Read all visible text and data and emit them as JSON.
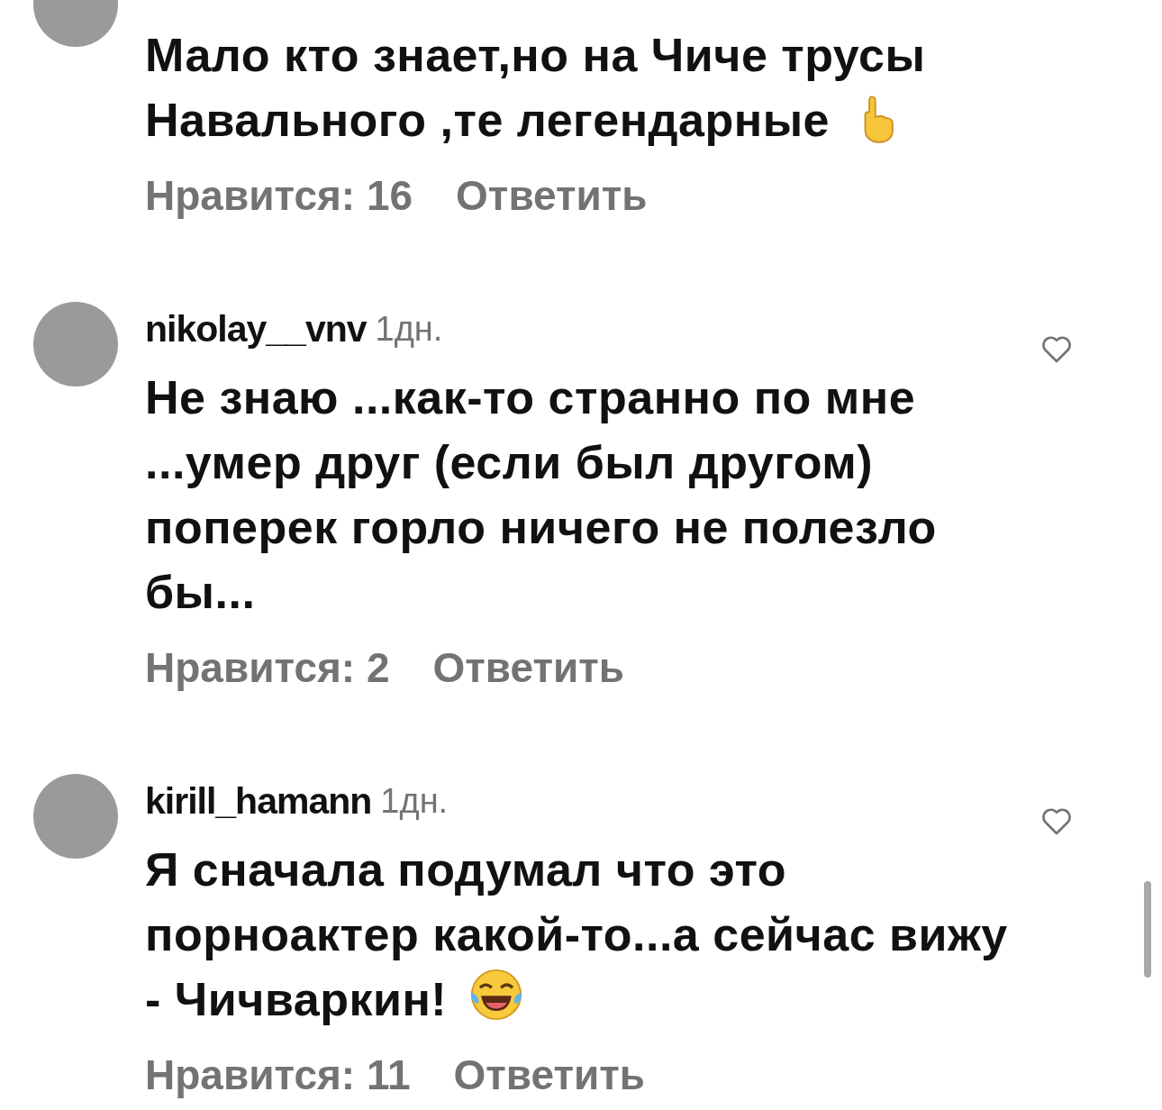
{
  "comments": [
    {
      "text": "Мало кто знает,но на Чиче трусы Навального ,те легендарные",
      "kind": "finger-emoji",
      "likes": "Нравится: 16",
      "reply": "Ответить"
    },
    {
      "username": "nikolay__vnv",
      "time": "1дн.",
      "kind": "plain",
      "text": "Не знаю ...как-то странно по мне ...умер друг (если был другом) поперек горло ничего не полезло бы...",
      "likes": "Нравится: 2",
      "reply": "Ответить"
    },
    {
      "username": "kirill_hamann",
      "time": "1дн.",
      "text": "Я сначала подумал что это порноактер какой-то...а сейчас вижу - Чичваркин!",
      "kind": "laugh-emoji",
      "likes": "Нравится: 11",
      "reply": "Ответить"
    }
  ]
}
